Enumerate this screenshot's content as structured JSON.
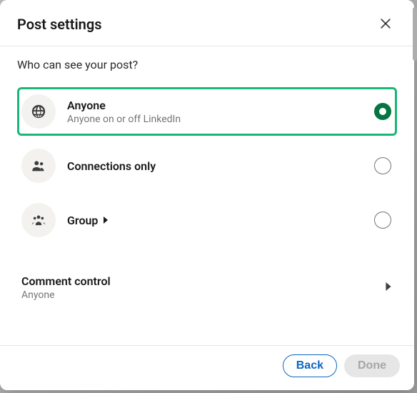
{
  "header": {
    "title": "Post settings"
  },
  "body": {
    "question": "Who can see your post?",
    "options": [
      {
        "id": "anyone",
        "title": "Anyone",
        "subtitle": "Anyone on or off LinkedIn",
        "selected": true,
        "highlighted": true
      },
      {
        "id": "connections",
        "title": "Connections only",
        "subtitle": "",
        "selected": false,
        "highlighted": false
      },
      {
        "id": "group",
        "title": "Group",
        "subtitle": "",
        "selected": false,
        "highlighted": false,
        "has_submenu": true
      }
    ],
    "comment_control": {
      "title": "Comment control",
      "value": "Anyone"
    }
  },
  "footer": {
    "back_label": "Back",
    "done_label": "Done",
    "done_enabled": false
  },
  "colors": {
    "highlight_border": "#1bb776",
    "radio_selected": "#057642",
    "primary": "#0a66c2"
  }
}
